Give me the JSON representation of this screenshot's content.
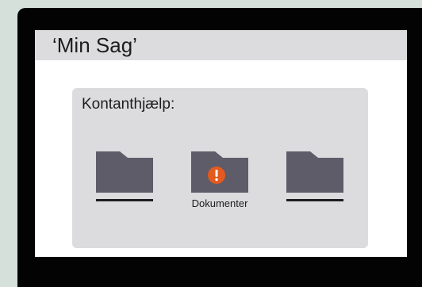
{
  "screen": {
    "title": "‘Min Sag’"
  },
  "panel": {
    "heading": "Kontanthjælp:",
    "folders": [
      {
        "label": "",
        "icon": "folder-icon",
        "has_alert": false
      },
      {
        "label": "Dokumenter",
        "icon": "folder-icon",
        "has_alert": true,
        "alert_icon": "exclamation-alert-icon"
      },
      {
        "label": "",
        "icon": "folder-icon",
        "has_alert": false
      }
    ]
  },
  "colors": {
    "background": "#d5e0db",
    "device_frame": "#030303",
    "title_bar": "#dcdbdd",
    "panel": "#dcdbdd",
    "folder": "#5e5c69",
    "alert": "#e35a1f"
  }
}
